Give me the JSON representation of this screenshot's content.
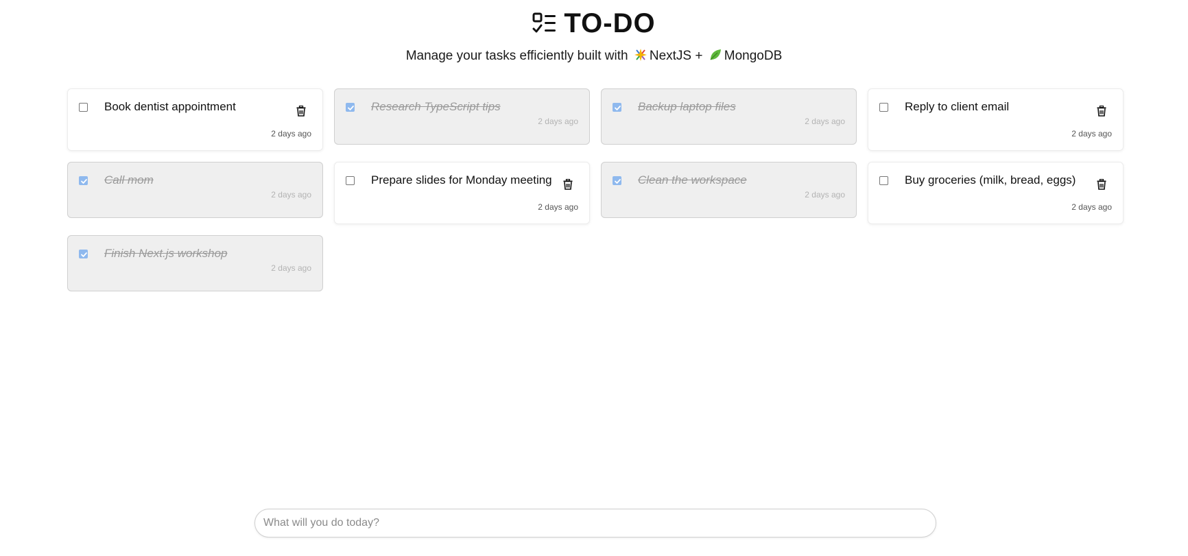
{
  "header": {
    "title": "TO-DO",
    "logo_icon": "checklist-icon",
    "subtitle_prefix": "Manage your tasks efficiently built with",
    "tech_1": "NextJS",
    "tech_1_icon": "sparkle-emoji-icon",
    "plus": "+",
    "tech_2": "MongoDB",
    "tech_2_icon": "leaf-emoji-icon"
  },
  "tasks": [
    {
      "title": "Book dentist appointment",
      "completed": false,
      "time": "2 days ago"
    },
    {
      "title": "Research TypeScript tips",
      "completed": true,
      "time": "2 days ago"
    },
    {
      "title": "Backup laptop files",
      "completed": true,
      "time": "2 days ago"
    },
    {
      "title": "Reply to client email",
      "completed": false,
      "time": "2 days ago"
    },
    {
      "title": "Call mom",
      "completed": true,
      "time": "2 days ago"
    },
    {
      "title": "Prepare slides for Monday meeting",
      "completed": false,
      "time": "2 days ago"
    },
    {
      "title": "Clean the workspace",
      "completed": true,
      "time": "2 days ago"
    },
    {
      "title": "Buy groceries (milk, bread, eggs)",
      "completed": false,
      "time": "2 days ago"
    },
    {
      "title": "Finish Next.js workshop",
      "completed": true,
      "time": "2 days ago"
    }
  ],
  "new_task": {
    "value": "",
    "placeholder": "What will you do today?"
  },
  "colors": {
    "checked": "#8fb9ee",
    "completed_bg": "#efefef",
    "completed_text": "#9a9a9a"
  }
}
